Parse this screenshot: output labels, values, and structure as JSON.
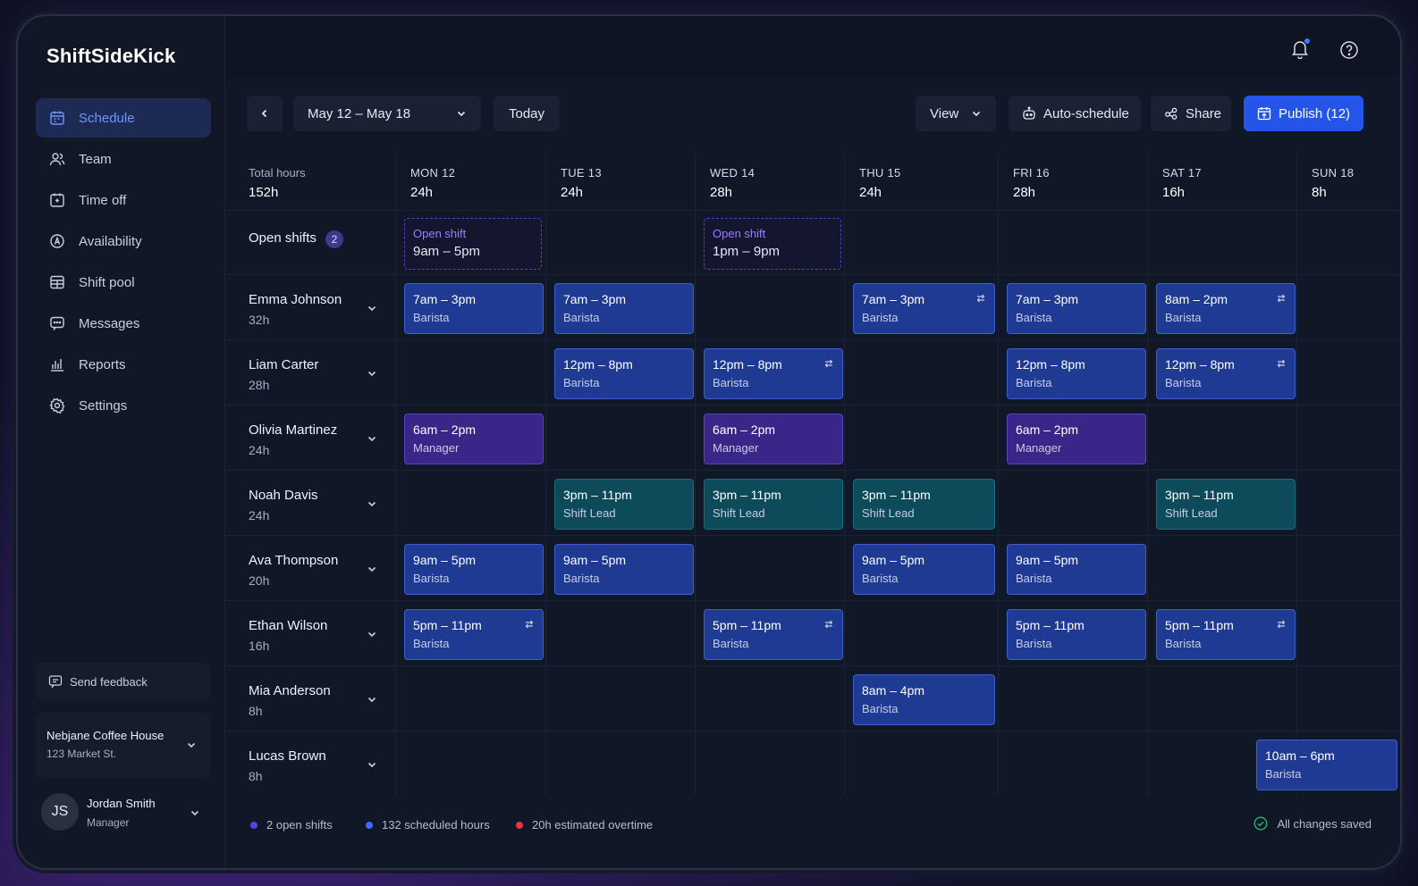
{
  "app": {
    "name": "ShiftSideKick"
  },
  "sidebar": {
    "items": [
      {
        "label": "Schedule",
        "icon": "calendar-icon",
        "active": true
      },
      {
        "label": "Team",
        "icon": "team-icon"
      },
      {
        "label": "Time off",
        "icon": "time-off-icon"
      },
      {
        "label": "Availability",
        "icon": "availability-icon"
      },
      {
        "label": "Shift pool",
        "icon": "shift-pool-icon"
      },
      {
        "label": "Messages",
        "icon": "message-icon"
      },
      {
        "label": "Reports",
        "icon": "reports-icon"
      },
      {
        "label": "Settings",
        "icon": "gear-icon"
      }
    ],
    "feedback_label": "Send feedback",
    "workspace": {
      "name": "Nebjane Coffee House",
      "address": "123 Market St."
    },
    "user": {
      "initials": "JS",
      "name": "Jordan Smith",
      "role": "Manager"
    }
  },
  "toolbar": {
    "date_range": "May 12 – May 18",
    "today_label": "Today",
    "view_label": "View",
    "auto_schedule_label": "Auto-schedule",
    "share_label": "Share",
    "publish_label": "Publish (12)"
  },
  "grid": {
    "total_label": "Total hours",
    "total_hours": "152h",
    "days": [
      {
        "day": "MON 12",
        "hours": "24h"
      },
      {
        "day": "TUE 13",
        "hours": "24h"
      },
      {
        "day": "WED 14",
        "hours": "28h"
      },
      {
        "day": "THU 15",
        "hours": "24h"
      },
      {
        "day": "FRI 16",
        "hours": "28h"
      },
      {
        "day": "SAT 17",
        "hours": "16h"
      },
      {
        "day": "SUN 18",
        "hours": "8h"
      }
    ],
    "open_shifts": {
      "label": "Open shifts",
      "count": "2",
      "shifts": [
        {
          "day": 0,
          "tag": "Open shift",
          "time": "9am – 5pm"
        },
        {
          "day": 2,
          "tag": "Open shift",
          "time": "1pm – 9pm"
        }
      ]
    },
    "employees": [
      {
        "name": "Emma Johnson",
        "hours": "32h",
        "shifts": [
          {
            "day": 0,
            "time": "7am – 3pm",
            "role": "Barista",
            "color": "blue"
          },
          {
            "day": 1,
            "time": "7am – 3pm",
            "role": "Barista",
            "color": "blue"
          },
          {
            "day": 3,
            "time": "7am – 3pm",
            "role": "Barista",
            "color": "blue",
            "swap": true
          },
          {
            "day": 4,
            "time": "7am – 3pm",
            "role": "Barista",
            "color": "blue"
          },
          {
            "day": 5,
            "time": "8am – 2pm",
            "role": "Barista",
            "color": "blue",
            "swap": true
          }
        ]
      },
      {
        "name": "Liam Carter",
        "hours": "28h",
        "shifts": [
          {
            "day": 1,
            "time": "12pm – 8pm",
            "role": "Barista",
            "color": "blue"
          },
          {
            "day": 2,
            "time": "12pm – 8pm",
            "role": "Barista",
            "color": "blue",
            "swap": true
          },
          {
            "day": 4,
            "time": "12pm – 8pm",
            "role": "Barista",
            "color": "blue"
          },
          {
            "day": 5,
            "time": "12pm – 8pm",
            "role": "Barista",
            "color": "blue",
            "swap": true
          }
        ]
      },
      {
        "name": "Olivia Martinez",
        "hours": "24h",
        "shifts": [
          {
            "day": 0,
            "time": "6am – 2pm",
            "role": "Manager",
            "color": "purple"
          },
          {
            "day": 2,
            "time": "6am – 2pm",
            "role": "Manager",
            "color": "purple"
          },
          {
            "day": 4,
            "time": "6am – 2pm",
            "role": "Manager",
            "color": "purple"
          }
        ]
      },
      {
        "name": "Noah Davis",
        "hours": "24h",
        "shifts": [
          {
            "day": 1,
            "time": "3pm – 11pm",
            "role": "Shift Lead",
            "color": "teal"
          },
          {
            "day": 2,
            "time": "3pm – 11pm",
            "role": "Shift Lead",
            "color": "teal"
          },
          {
            "day": 3,
            "time": "3pm – 11pm",
            "role": "Shift Lead",
            "color": "teal"
          },
          {
            "day": 5,
            "time": "3pm – 11pm",
            "role": "Shift Lead",
            "color": "teal"
          }
        ]
      },
      {
        "name": "Ava Thompson",
        "hours": "20h",
        "shifts": [
          {
            "day": 0,
            "time": "9am – 5pm",
            "role": "Barista",
            "color": "blue"
          },
          {
            "day": 1,
            "time": "9am – 5pm",
            "role": "Barista",
            "color": "blue"
          },
          {
            "day": 3,
            "time": "9am – 5pm",
            "role": "Barista",
            "color": "blue"
          },
          {
            "day": 4,
            "time": "9am – 5pm",
            "role": "Barista",
            "color": "blue"
          }
        ]
      },
      {
        "name": "Ethan Wilson",
        "hours": "16h",
        "shifts": [
          {
            "day": 0,
            "time": "5pm – 11pm",
            "role": "Barista",
            "color": "blue",
            "swap": true
          },
          {
            "day": 2,
            "time": "5pm – 11pm",
            "role": "Barista",
            "color": "blue",
            "swap": true
          },
          {
            "day": 4,
            "time": "5pm – 11pm",
            "role": "Barista",
            "color": "blue"
          },
          {
            "day": 5,
            "time": "5pm – 11pm",
            "role": "Barista",
            "color": "blue",
            "swap": true
          }
        ]
      },
      {
        "name": "Mia Anderson",
        "hours": "8h",
        "shifts": [
          {
            "day": 3,
            "time": "8am – 4pm",
            "role": "Barista",
            "color": "blue"
          }
        ]
      },
      {
        "name": "Lucas Brown",
        "hours": "8h",
        "shifts": [
          {
            "day": 6,
            "time": "10am – 6pm",
            "role": "Barista",
            "color": "blue"
          }
        ]
      }
    ]
  },
  "footer": {
    "legend": [
      {
        "label": "2 open shifts",
        "color": "#5b45d6"
      },
      {
        "label": "132 scheduled hours",
        "color": "#3d6bff"
      },
      {
        "label": "20h estimated overtime",
        "color": "#e8363f"
      }
    ],
    "status": "All changes saved"
  }
}
